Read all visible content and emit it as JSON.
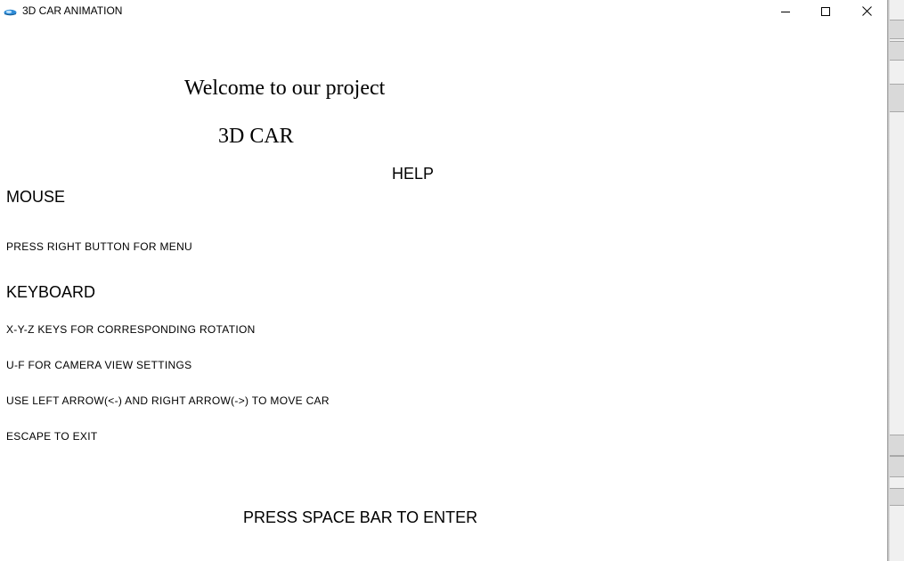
{
  "window": {
    "title": "3D CAR ANIMATION",
    "minimize_icon": "minimize-icon",
    "maximize_icon": "maximize-icon",
    "close_icon": "close-icon"
  },
  "content": {
    "welcome": "Welcome to our project",
    "project_name": "3D CAR",
    "help_heading": "HELP",
    "mouse_heading": "MOUSE",
    "mouse_instruction": "PRESS RIGHT BUTTON FOR MENU",
    "keyboard_heading": "KEYBOARD",
    "keyboard_instructions": [
      "X-Y-Z KEYS FOR CORRESPONDING ROTATION",
      "U-F FOR CAMERA VIEW SETTINGS",
      "USE LEFT ARROW(<-) AND RIGHT ARROW(->) TO MOVE CAR",
      "ESCAPE TO EXIT"
    ],
    "enter_prompt": "PRESS SPACE BAR TO ENTER"
  },
  "colors": {
    "background": "#ffffff",
    "text": "#000000"
  }
}
